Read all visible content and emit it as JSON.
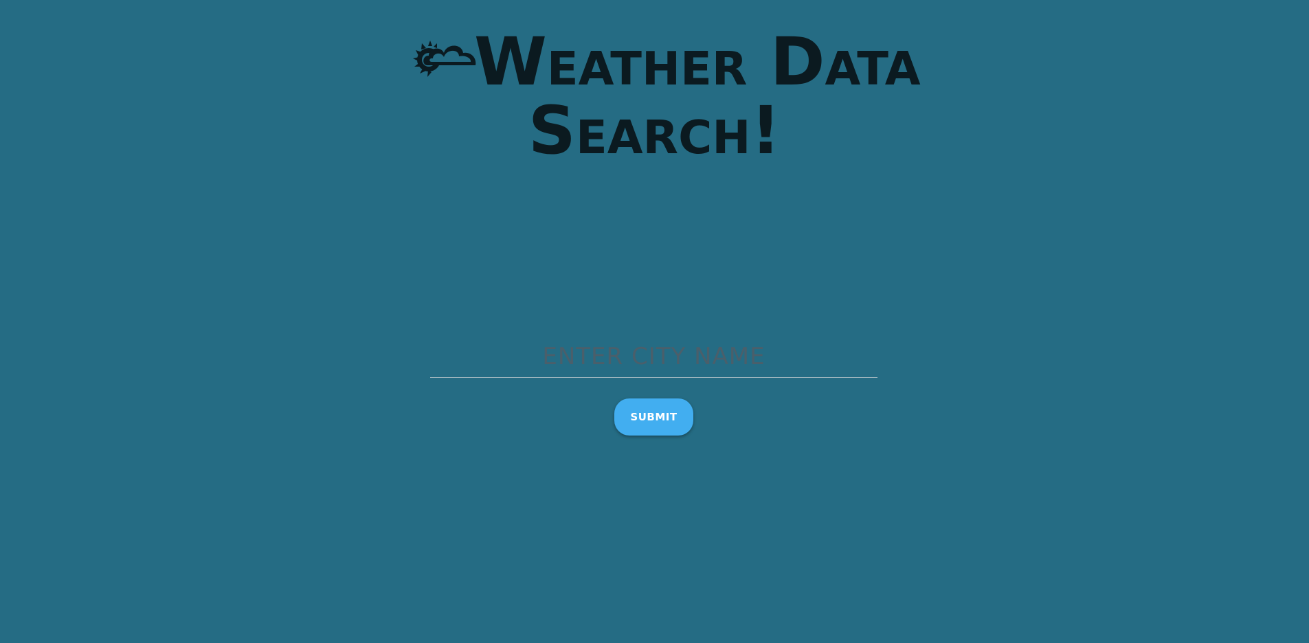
{
  "header": {
    "icon": "sun-behind-cloud-icon",
    "title_line1": "Weather Data",
    "title_line2": "Search!"
  },
  "search": {
    "placeholder": "ENTER CITY NAME",
    "value": ""
  },
  "submit": {
    "label": "SUBMIT"
  },
  "colors": {
    "background": "#256c84",
    "title": "#0b1a20",
    "button": "#42aef0",
    "button_text": "#ffffff",
    "placeholder": "#4a5f6b"
  }
}
